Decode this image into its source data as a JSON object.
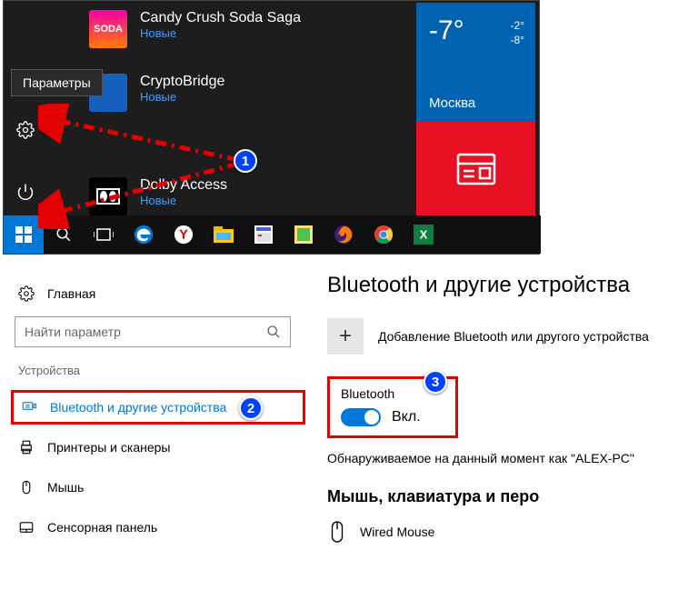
{
  "start_menu": {
    "tooltip": "Параметры",
    "apps": [
      {
        "title": "Candy Crush Soda Saga",
        "subtitle": "Новые"
      },
      {
        "title": "CryptoBridge",
        "subtitle": "Новые"
      },
      {
        "title": "Dolby Access",
        "subtitle": "Новые"
      }
    ],
    "weather": {
      "temp": "-7°",
      "hi": "-2°",
      "lo": "-8°",
      "city": "Москва"
    }
  },
  "callouts": {
    "c1": "1",
    "c2": "2",
    "c3": "3"
  },
  "settings": {
    "home": "Главная",
    "search_placeholder": "Найти параметр",
    "section": "Устройства",
    "nav": {
      "bluetooth": "Bluetooth и другие устройства",
      "printers": "Принтеры и сканеры",
      "mouse": "Мышь",
      "touchpad": "Сенсорная панель"
    },
    "page_title": "Bluetooth и другие устройства",
    "add_label": "Добавление Bluetooth или другого устройства",
    "bt_label": "Bluetooth",
    "bt_state": "Вкл.",
    "discoverable": "Обнаруживаемое на данный момент как \"ALEX-PC\"",
    "section2": "Мышь, клавиатура и перо",
    "device": "Wired Mouse"
  }
}
